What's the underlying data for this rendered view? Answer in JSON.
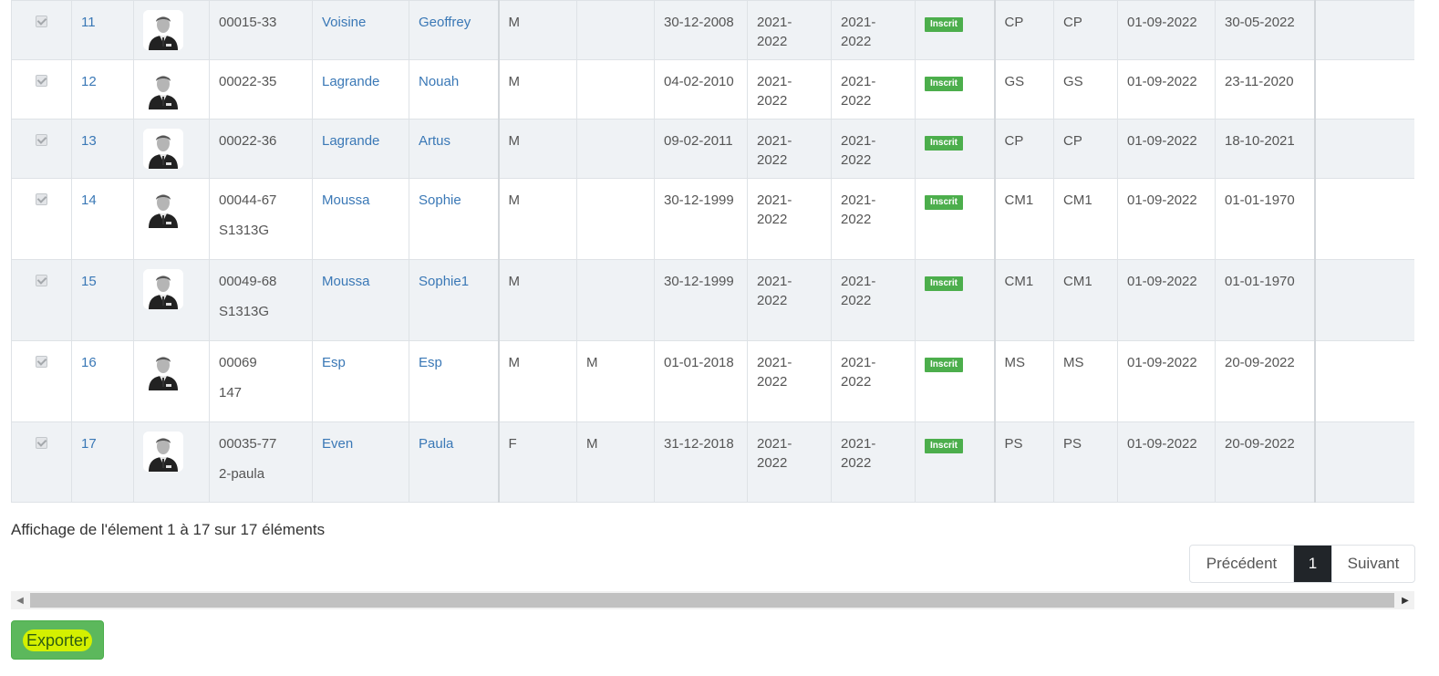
{
  "colors": {
    "badge": "#4cae4c",
    "link": "#3a78b6",
    "active_page": "#212529",
    "export_button": "#5cb85c",
    "export_highlight": "#d4f000"
  },
  "rows": [
    {
      "num": "11",
      "code": "00015-33",
      "code2": "",
      "nom": "Voisine",
      "prenom": "Geoffrey",
      "sexe": "M",
      "col8": "",
      "naissance": "30-12-2008",
      "annee1a": "2021-",
      "annee1b": "2022",
      "annee2a": "2021-",
      "annee2b": "2022",
      "statut": "Inscrit",
      "classe1": "CP",
      "classe2": "CP",
      "date_debut": "01-09-2022",
      "date_fin": "30-05-2022"
    },
    {
      "num": "12",
      "code": "00022-35",
      "code2": "",
      "nom": "Lagrande",
      "prenom": "Nouah",
      "sexe": "M",
      "col8": "",
      "naissance": "04-02-2010",
      "annee1a": "2021-",
      "annee1b": "2022",
      "annee2a": "2021-",
      "annee2b": "2022",
      "statut": "Inscrit",
      "classe1": "GS",
      "classe2": "GS",
      "date_debut": "01-09-2022",
      "date_fin": "23-11-2020"
    },
    {
      "num": "13",
      "code": "00022-36",
      "code2": "",
      "nom": "Lagrande",
      "prenom": "Artus",
      "sexe": "M",
      "col8": "",
      "naissance": "09-02-2011",
      "annee1a": "2021-",
      "annee1b": "2022",
      "annee2a": "2021-",
      "annee2b": "2022",
      "statut": "Inscrit",
      "classe1": "CP",
      "classe2": "CP",
      "date_debut": "01-09-2022",
      "date_fin": "18-10-2021"
    },
    {
      "num": "14",
      "code": "00044-67",
      "code2": "S1313G",
      "nom": "Moussa",
      "prenom": "Sophie",
      "sexe": "M",
      "col8": "",
      "naissance": "30-12-1999",
      "annee1a": "2021-",
      "annee1b": "2022",
      "annee2a": "2021-",
      "annee2b": "2022",
      "statut": "Inscrit",
      "classe1": "CM1",
      "classe2": "CM1",
      "date_debut": "01-09-2022",
      "date_fin": "01-01-1970"
    },
    {
      "num": "15",
      "code": "00049-68",
      "code2": "S1313G",
      "nom": "Moussa",
      "prenom": "Sophie1",
      "sexe": "M",
      "col8": "",
      "naissance": "30-12-1999",
      "annee1a": "2021-",
      "annee1b": "2022",
      "annee2a": "2021-",
      "annee2b": "2022",
      "statut": "Inscrit",
      "classe1": "CM1",
      "classe2": "CM1",
      "date_debut": "01-09-2022",
      "date_fin": "01-01-1970"
    },
    {
      "num": "16",
      "code": "00069",
      "code2": "147",
      "nom": "Esp",
      "prenom": "Esp",
      "sexe": "M",
      "col8": "M",
      "naissance": "01-01-2018",
      "annee1a": "2021-",
      "annee1b": "2022",
      "annee2a": "2021-",
      "annee2b": "2022",
      "statut": "Inscrit",
      "classe1": "MS",
      "classe2": "MS",
      "date_debut": "01-09-2022",
      "date_fin": "20-09-2022"
    },
    {
      "num": "17",
      "code": "00035-77",
      "code2": "2-paula",
      "nom": "Even",
      "prenom": "Paula",
      "sexe": "F",
      "col8": "M",
      "naissance": "31-12-2018",
      "annee1a": "2021-",
      "annee1b": "2022",
      "annee2a": "2021-",
      "annee2b": "2022",
      "statut": "Inscrit",
      "classe1": "PS",
      "classe2": "PS",
      "date_debut": "01-09-2022",
      "date_fin": "20-09-2022"
    }
  ],
  "summary": "Affichage de l'élement 1 à 17 sur 17 éléments",
  "pagination": {
    "prev": "Précédent",
    "current": "1",
    "next": "Suivant"
  },
  "export_label": "Exporter"
}
